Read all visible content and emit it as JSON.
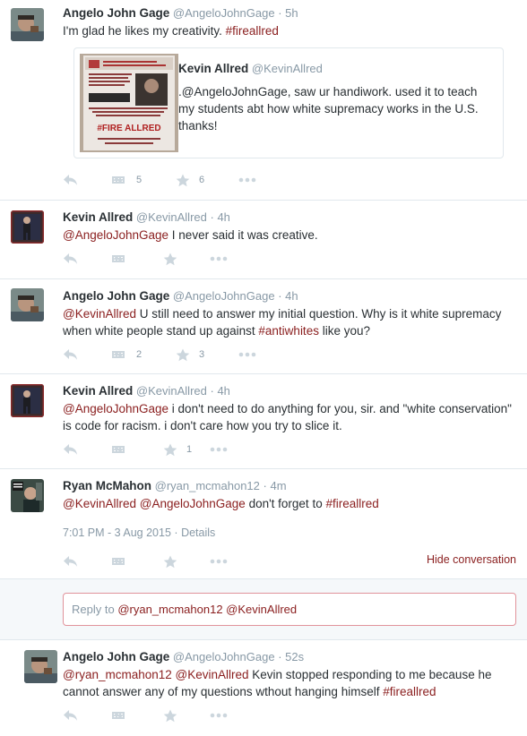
{
  "tweets": [
    {
      "fullname": "Angelo John Gage",
      "username": "@AngeloJohnGage",
      "time": "5h",
      "text_plain": "I'm glad he likes my creativity. ",
      "hashtag": "#fireallred",
      "quote": {
        "fullname": "Kevin Allred",
        "username": "@KevinAllred",
        "text": ".@AngeloJohnGage, saw ur handiwork. used it to teach my students abt how white supremacy works in the U.S. thanks!",
        "poster_lines": [
          "#FIRE ALLRED"
        ]
      },
      "retweets": "5",
      "favorites": "6"
    },
    {
      "fullname": "Kevin Allred",
      "username": "@KevinAllred",
      "time": "4h",
      "mention": "@AngeloJohnGage",
      "text_plain": " I never said it was creative."
    },
    {
      "fullname": "Angelo John Gage",
      "username": "@AngeloJohnGage",
      "time": "4h",
      "mention": "@KevinAllred",
      "text_plain": " U still need to answer my initial question. Why is it white supremacy when white people stand up against ",
      "hashtag": "#antiwhites",
      "text_tail": " like you?",
      "retweets": "2",
      "favorites": "3"
    },
    {
      "fullname": "Kevin Allred",
      "username": "@KevinAllred",
      "time": "4h",
      "mention": "@AngeloJohnGage",
      "text_plain": " i don't need to do anything for you, sir. and \"white conservation\" is code for racism. i don't care how you try to slice it.",
      "favorites": "1"
    },
    {
      "fullname": "Ryan McMahon",
      "username": "@ryan_mcmahon12",
      "time": "4m",
      "mention1": "@KevinAllred",
      "mention2": "@AngeloJohnGage",
      "text_plain": " don't forget to ",
      "hashtag": "#fireallred",
      "timestamp": "7:01 PM - 3 Aug 2015",
      "details": "Details",
      "hide": "Hide conversation"
    },
    {
      "fullname": "Angelo John Gage",
      "username": "@AngeloJohnGage",
      "time": "52s",
      "mention1": "@ryan_mcmahon12",
      "mention2": "@KevinAllred",
      "text_plain": " Kevin stopped responding to me because he cannot answer any of my questions wthout hanging himself ",
      "hashtag": "#fireallred"
    }
  ],
  "reply": {
    "prefix": "Reply to ",
    "mentions": "@ryan_mcmahon12 @KevinAllred"
  },
  "colors": {
    "accent": "#8a1e1e",
    "muted": "#8899a6",
    "icon": "#ccd6dd"
  },
  "icons": [
    "reply-icon",
    "retweet-icon",
    "favorite-icon",
    "more-icon"
  ]
}
